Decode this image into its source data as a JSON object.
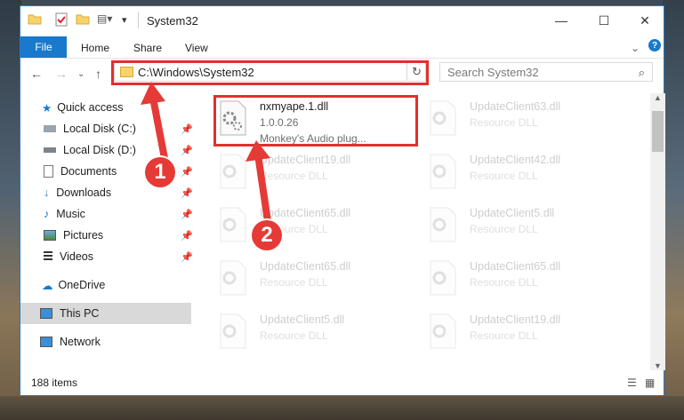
{
  "window": {
    "title": "System32"
  },
  "ribbon": {
    "file": "File",
    "home": "Home",
    "share": "Share",
    "view": "View"
  },
  "nav": {
    "address": "C:\\Windows\\System32",
    "search_placeholder": "Search System32"
  },
  "sidebar": {
    "items": [
      {
        "label": "Quick access"
      },
      {
        "label": "Local Disk (C:)"
      },
      {
        "label": "Local Disk (D:)"
      },
      {
        "label": "Documents"
      },
      {
        "label": "Downloads"
      },
      {
        "label": "Music"
      },
      {
        "label": "Pictures"
      },
      {
        "label": "Videos"
      },
      {
        "label": "OneDrive"
      },
      {
        "label": "This PC"
      },
      {
        "label": "Network"
      }
    ]
  },
  "files": [
    {
      "name": "nxmyape.1.dll",
      "line1": "1.0.0.26",
      "line2": "Monkey's Audio plug..."
    },
    {
      "name": "UpdateClient63.dll",
      "line1": "Resource DLL"
    },
    {
      "name": "UpdateClient19.dll",
      "line1": "Resource DLL"
    },
    {
      "name": "UpdateClient42.dll",
      "line1": "Resource DLL"
    },
    {
      "name": "UpdateClient65.dll",
      "line1": "Resource DLL"
    },
    {
      "name": "UpdateClient5.dll",
      "line1": "Resource DLL"
    },
    {
      "name": "UpdateClient65.dll",
      "line1": "Resource DLL"
    },
    {
      "name": "UpdateClient65.dll",
      "line1": "Resource DLL"
    },
    {
      "name": "UpdateClient5.dll",
      "line1": "Resource DLL"
    },
    {
      "name": "UpdateClient19.dll",
      "line1": "Resource DLL"
    }
  ],
  "status": {
    "items": "188 items"
  },
  "callouts": {
    "one": "1",
    "two": "2"
  },
  "colors": {
    "accent": "#1979ca",
    "highlight": "#e0302f"
  }
}
